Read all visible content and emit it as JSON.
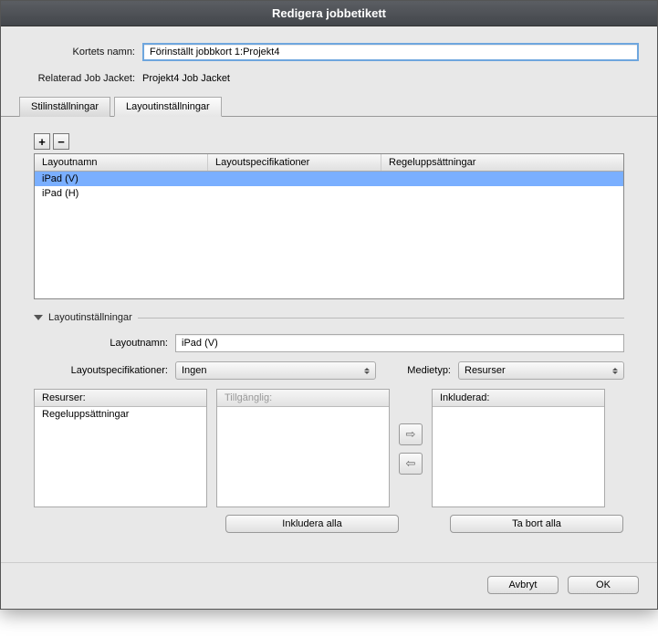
{
  "title": "Redigera jobbetikett",
  "fields": {
    "card_name_label": "Kortets namn:",
    "card_name_value": "Förinställt jobbkort 1:Projekt4",
    "related_jacket_label": "Relaterad Job Jacket:",
    "related_jacket_value": "Projekt4 Job Jacket"
  },
  "tabs": {
    "style": "Stilinställningar",
    "layout": "Layoutinställningar"
  },
  "table": {
    "headers": {
      "name": "Layoutnamn",
      "specs": "Layoutspecifikationer",
      "rules": "Regeluppsättningar"
    },
    "rows": [
      {
        "name": "iPad (V)",
        "specs": "",
        "rules": ""
      },
      {
        "name": "iPad (H)",
        "specs": "",
        "rules": ""
      }
    ]
  },
  "section": {
    "title": "Layoutinställningar",
    "layout_name_label": "Layoutnamn:",
    "layout_name_value": "iPad (V)",
    "specs_label": "Layoutspecifikationer:",
    "specs_value": "Ingen",
    "media_label": "Medietyp:",
    "media_value": "Resurser"
  },
  "lists": {
    "resources_header": "Resurser:",
    "resources_item": "Regeluppsättningar",
    "available_header": "Tillgänglig:",
    "included_header": "Inkluderad:"
  },
  "buttons": {
    "plus": "+",
    "minus": "−",
    "include_all": "Inkludera alla",
    "remove_all": "Ta bort alla",
    "arrow_right": "⇨",
    "arrow_left": "⇦",
    "cancel": "Avbryt",
    "ok": "OK"
  }
}
